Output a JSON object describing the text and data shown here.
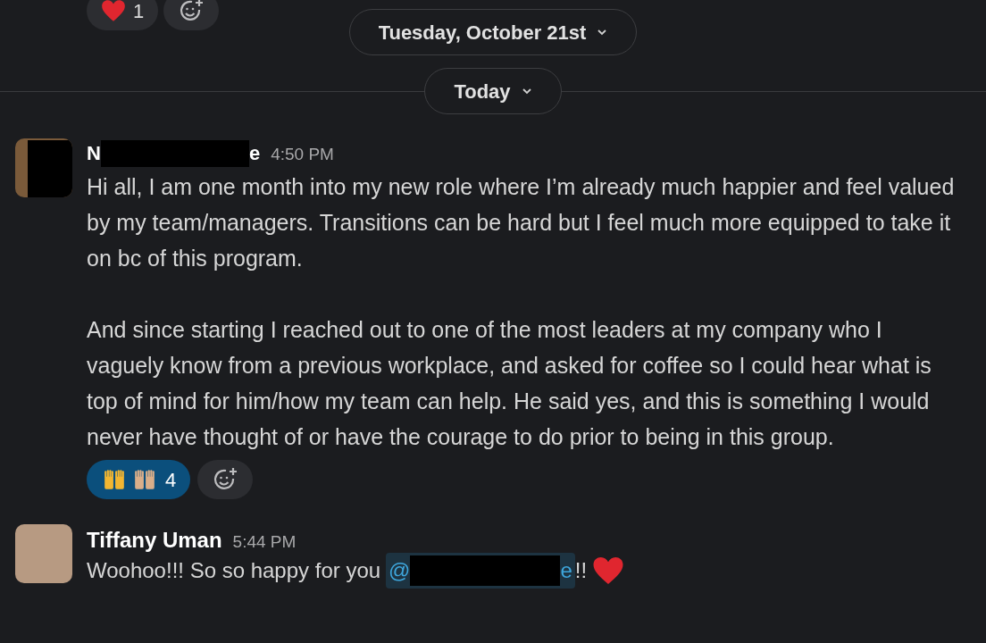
{
  "top_reactions": [
    {
      "kind": "heart",
      "count": "1",
      "selected": false
    }
  ],
  "date_dividers": [
    {
      "label": "Tuesday, October 21st",
      "line": false
    },
    {
      "label": "Today",
      "line": true
    }
  ],
  "messages": [
    {
      "name_start": "N",
      "name_end": "e",
      "time": "4:50 PM",
      "avatar": {
        "kind": "redacted"
      },
      "paragraphs": [
        "Hi all, I am one month into my new role where I’m already much happier and feel valued by my team/managers. Transitions can be hard but I feel much more equipped to take it on bc of this program.",
        "And since starting I reached out to one of the most leaders at my company who I vaguely know from a previous workplace, and asked for coffee so I could hear what is top of mind for him/how my team can help. He said yes, and this is something I would never have thought of or have the courage to do prior to being in this group."
      ],
      "reactions": [
        {
          "kind": "raised-hands",
          "count": "4",
          "selected": true
        }
      ]
    },
    {
      "name": "Tiffany Uman",
      "time": "5:44 PM",
      "avatar": {
        "kind": "photo"
      },
      "text": "Woohoo!!! So so happy for you",
      "mention": {
        "prefix": "@",
        "suffix": "e"
      },
      "after": "!!",
      "trailing_icon": {
        "kind": "heart"
      }
    }
  ]
}
